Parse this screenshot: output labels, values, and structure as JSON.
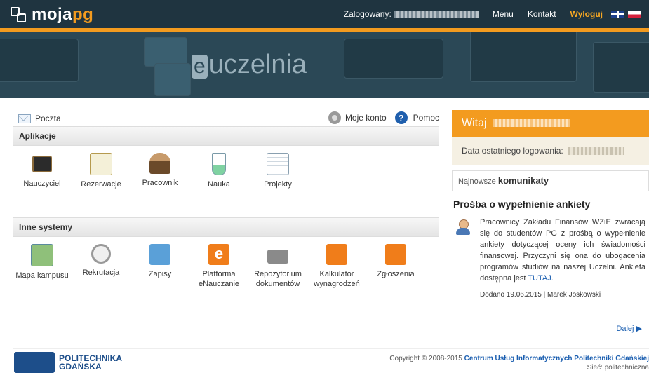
{
  "header": {
    "logo_text_a": "moja",
    "logo_text_b": "pg",
    "logged_in_label": "Zalogowany:",
    "menu": "Menu",
    "contact": "Kontakt",
    "logout": "Wyloguj"
  },
  "banner": {
    "title_e": "e",
    "title_rest": "uczelnia"
  },
  "links": {
    "mail": "Poczta",
    "account": "Moje konto",
    "help": "Pomoc"
  },
  "sections": {
    "apps_title": "Aplikacje",
    "apps": [
      {
        "label": "Nauczyciel",
        "icon": "blackboard-icon"
      },
      {
        "label": "Rezerwacje",
        "icon": "calendar-icon"
      },
      {
        "label": "Pracownik",
        "icon": "worker-icon"
      },
      {
        "label": "Nauka",
        "icon": "flask-icon"
      },
      {
        "label": "Projekty",
        "icon": "spreadsheet-icon"
      }
    ],
    "other_title": "Inne systemy",
    "other": [
      {
        "label": "Mapa kampusu",
        "icon": "map-icon"
      },
      {
        "label": "Rekrutacja",
        "icon": "magnifier-icon"
      },
      {
        "label": "Zapisy",
        "icon": "cube-add-icon"
      },
      {
        "label": "Platforma eNauczanie",
        "icon": "e-icon"
      },
      {
        "label": "Repozytorium dokumentów",
        "icon": "folder-icon"
      },
      {
        "label": "Kalkulator wynagrodzeń",
        "icon": "calculator-icon"
      },
      {
        "label": "Zgłoszenia",
        "icon": "edit-icon"
      }
    ]
  },
  "sidebar": {
    "welcome": "Witaj",
    "last_login": "Data ostatniego logowania:",
    "news_prefix": "Najnowsze",
    "news_title": "komunikaty",
    "item_title": "Prośba o wypełnienie ankiety",
    "item_body": "Pracownicy Zakładu Finansów WZiE zwracają się do studentów PG z prośbą o wypełnienie ankiety dotyczącej oceny ich świadomości finansowej. Przyczyni się ona do ubogacenia programów studiów na naszej Uczelni. Ankieta dostępna jest",
    "item_link": "TUTAJ.",
    "item_added": "Dodano 19.06.2015 | Marek Joskowski",
    "more": "Dalej"
  },
  "footer": {
    "pg_line1": "POLITECHNIKA",
    "pg_line2": "GDAŃSKA",
    "copyright": "Copyright © 2008-2015",
    "org": "Centrum Usług Informatycznych Politechniki Gdańskiej",
    "network": "Sieć: politechniczna"
  },
  "colors": {
    "accent": "#f39b1f",
    "dark": "#1f3440",
    "link": "#1a5eb0"
  }
}
